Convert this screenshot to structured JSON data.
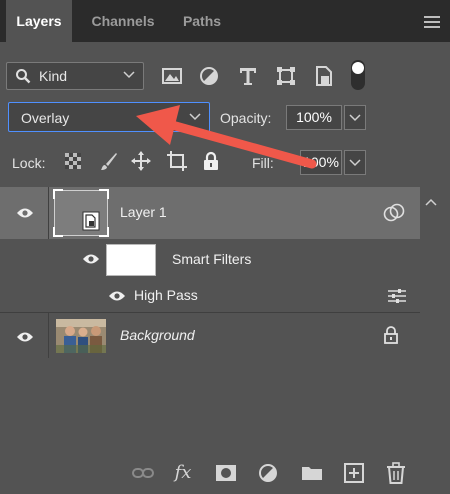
{
  "tabs": [
    {
      "label": "Layers",
      "active": true
    },
    {
      "label": "Channels",
      "active": false
    },
    {
      "label": "Paths",
      "active": false
    }
  ],
  "filter": {
    "kind_label": "Kind",
    "icons": [
      "image-filter-icon",
      "adjustment-filter-icon",
      "type-filter-icon",
      "shape-filter-icon",
      "smart-object-filter-icon"
    ],
    "toggle_on": true
  },
  "blend": {
    "mode": "Overlay",
    "opacity_label": "Opacity:",
    "opacity_value": "100%",
    "highlight_color": "#4f90ff"
  },
  "lock": {
    "label": "Lock:",
    "icons": [
      "lock-transparent-pixels-icon",
      "lock-image-pixels-icon",
      "lock-position-icon",
      "lock-artboard-icon",
      "lock-all-icon"
    ],
    "fill_label": "Fill:",
    "fill_value": "100%"
  },
  "layers": [
    {
      "name": "Layer 1",
      "type": "smart-object",
      "visible": true,
      "selected": true
    },
    {
      "name": "Smart Filters",
      "type": "smart-filters",
      "visible": true
    },
    {
      "name": "High Pass",
      "type": "filter",
      "visible": true
    },
    {
      "name": "Background",
      "type": "pixel",
      "visible": true,
      "locked": true
    }
  ],
  "annotation": {
    "color": "#f0584a",
    "points_to": "blend-mode-dropdown"
  },
  "bottom_toolbar": [
    "link-layers-icon",
    "fx-icon",
    "layer-mask-icon",
    "adjustment-layer-icon",
    "new-group-icon",
    "new-layer-icon",
    "delete-layer-icon"
  ],
  "fx_label": "fx"
}
